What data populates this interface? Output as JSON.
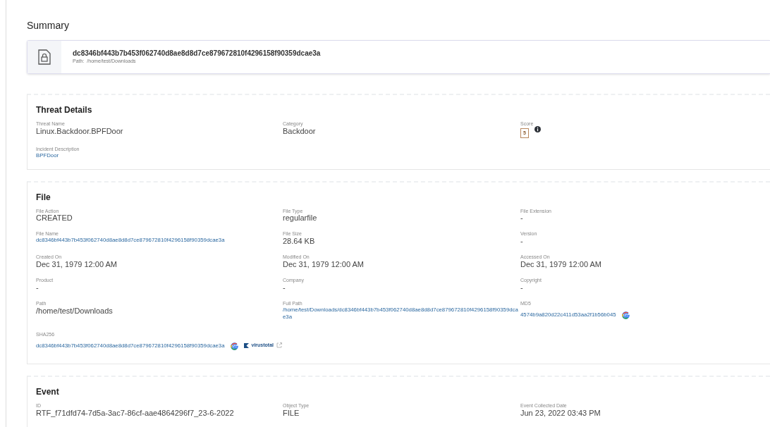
{
  "title": "Summary",
  "header": {
    "name": "dc8346bf443b7b453f062740d8ae8d8d7ce879672810f4296158f90359dcae3a",
    "path_label": "Path:",
    "path": "/home/test/Downloads"
  },
  "sections": [
    {
      "title": "Threat Details",
      "fields": [
        {
          "label": "Threat Name",
          "value": "Linux.Backdoor.BPFDoor",
          "kind": "text"
        },
        {
          "label": "Category",
          "value": "Backdoor",
          "kind": "text"
        },
        {
          "label": "Score",
          "value": "5",
          "kind": "score"
        },
        {
          "label": "Incident Description",
          "value": "BPFDoor",
          "kind": "link"
        }
      ]
    },
    {
      "title": "File",
      "fields": [
        {
          "label": "File Action",
          "value": "CREATED",
          "kind": "text"
        },
        {
          "label": "File Type",
          "value": "regularfile",
          "kind": "text"
        },
        {
          "label": "File Extension",
          "value": "-",
          "kind": "text"
        },
        {
          "label": "File Name",
          "value": "dc8346bf443b7b453f062740d8ae8d8d7ce879672810f4296158f90359dcae3a",
          "kind": "link"
        },
        {
          "label": "File Size",
          "value": "28.64 KB",
          "kind": "text"
        },
        {
          "label": "Version",
          "value": "-",
          "kind": "text"
        },
        {
          "label": "Created On",
          "value": "Dec 31, 1979 12:00 AM",
          "kind": "text"
        },
        {
          "label": "Modified On",
          "value": "Dec 31, 1979 12:00 AM",
          "kind": "text"
        },
        {
          "label": "Accessed On",
          "value": "Dec 31, 1979 12:00 AM",
          "kind": "text"
        },
        {
          "label": "Product",
          "value": "-",
          "kind": "text"
        },
        {
          "label": "Company",
          "value": "-",
          "kind": "text"
        },
        {
          "label": "Copyright",
          "value": "-",
          "kind": "text"
        },
        {
          "label": "Path",
          "value": "/home/test/Downloads",
          "kind": "text"
        },
        {
          "label": "Full Path",
          "value": "/home/test/Downloads/dc8346bf443b7b453f062740d8ae8d8d7ce879672810f4296158f90359dcae3a",
          "kind": "link"
        },
        {
          "label": "MD5",
          "value": "4574b9a820d22c411d53aa2f1b56b045",
          "kind": "link",
          "google": true
        },
        {
          "label": "SHA256",
          "value": "dc8346bf443b7b453f062740d8ae8d8d7ce879672810f4296158f90359dcae3a",
          "kind": "link",
          "google": true,
          "virustotal": "virustotal"
        }
      ]
    },
    {
      "title": "Event",
      "fields": [
        {
          "label": "ID",
          "value": "RTF_f71dfd74-7d5a-3ac7-86cf-aae4864296f7_23-6-2022",
          "kind": "text"
        },
        {
          "label": "Object Type",
          "value": "FILE",
          "kind": "text"
        },
        {
          "label": "Event Collected Date",
          "value": "Jun 23, 2022 03:43 PM",
          "kind": "text"
        }
      ]
    }
  ]
}
